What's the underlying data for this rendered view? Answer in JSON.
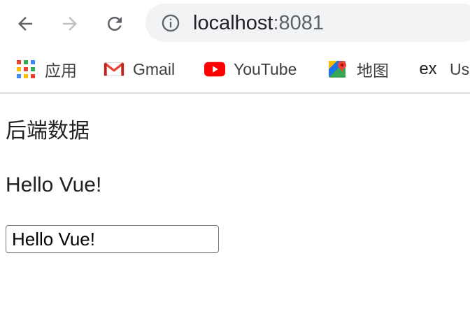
{
  "browser": {
    "url_host": "localhost",
    "url_port": ":8081",
    "bookmarks": [
      {
        "label": "应用",
        "icon": "apps-grid-icon"
      },
      {
        "label": "Gmail",
        "icon": "gmail-icon"
      },
      {
        "label": "YouTube",
        "icon": "youtube-icon"
      },
      {
        "label": "地图",
        "icon": "maps-icon"
      },
      {
        "label": "Us",
        "icon": "ex-icon",
        "icon_text": "ex"
      }
    ]
  },
  "page": {
    "heading": "后端数据",
    "message": "Hello Vue!",
    "input_value": "Hello Vue!"
  }
}
